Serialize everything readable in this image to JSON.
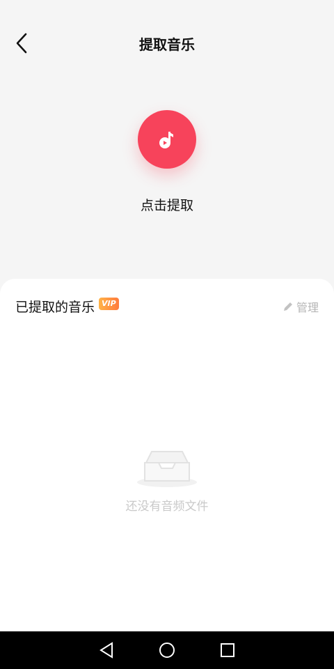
{
  "header": {
    "title": "提取音乐",
    "back_icon": "chevron-left-icon"
  },
  "extract": {
    "button_icon": "music-note-icon",
    "button_color": "#f7435b",
    "label": "点击提取"
  },
  "panel": {
    "title": "已提取的音乐",
    "vip_badge": "VIP",
    "manage_label": "管理",
    "manage_icon": "pencil-icon",
    "empty_icon": "empty-tray-icon",
    "empty_text": "还没有音频文件"
  },
  "navbar": {
    "back_icon": "triangle-back-icon",
    "home_icon": "circle-home-icon",
    "recents_icon": "square-recents-icon"
  }
}
